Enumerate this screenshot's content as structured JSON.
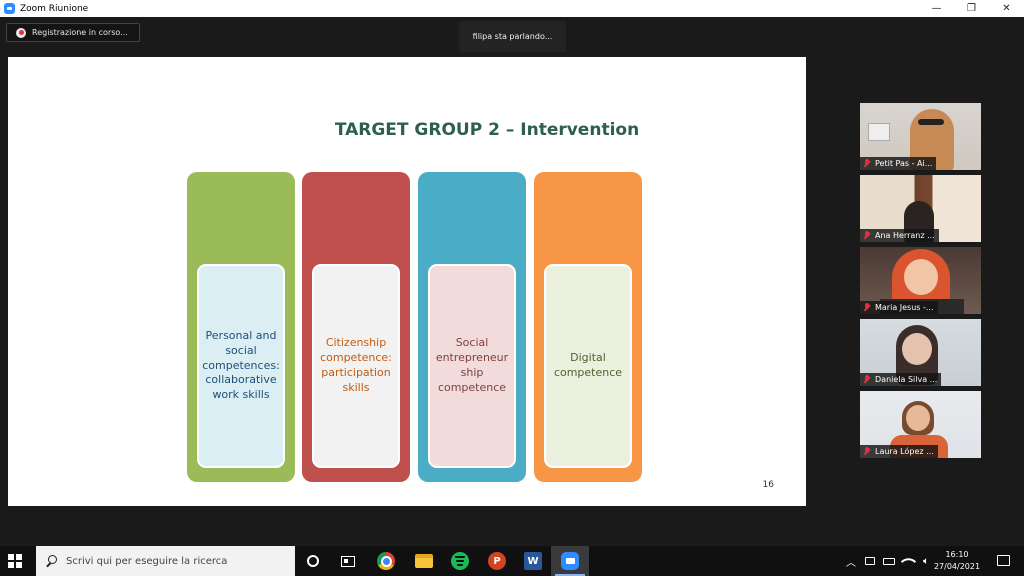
{
  "window": {
    "title": "Zoom Riunione",
    "minimize": "—",
    "restore": "❐",
    "close": "✕"
  },
  "meeting": {
    "recording_label": "Registrazione in corso...",
    "speaking_label": "filipa sta parlando..."
  },
  "slide": {
    "title": "TARGET GROUP 2 – Intervention",
    "page_number": "16",
    "columns": [
      {
        "text": "Personal and social competences: collaborative work skills",
        "outer_color": "#9bbb59",
        "inner_color": "#dbeef4",
        "text_color": "#1f4e79"
      },
      {
        "text": "Citizenship competence: participation skills",
        "outer_color": "#c0504d",
        "inner_color": "#f2f2f2",
        "text_color": "#c55a11"
      },
      {
        "text": "Social entrepreneur ship competence",
        "outer_color": "#4bacc6",
        "inner_color": "#f2dcdb",
        "text_color": "#7f3f3f"
      },
      {
        "text": "Digital competence",
        "outer_color": "#f79646",
        "inner_color": "#ebf1de",
        "text_color": "#4f6228"
      }
    ]
  },
  "participants": [
    {
      "name": "Petit Pas - Ai..."
    },
    {
      "name": "Ana Herranz ..."
    },
    {
      "name": "Maria Jesus -..."
    },
    {
      "name": "Daniela Silva ..."
    },
    {
      "name": "Laura López ..."
    }
  ],
  "taskbar": {
    "search_placeholder": "Scrivi qui per eseguire la ricerca",
    "ppt_letter": "P",
    "word_letter": "W",
    "time": "16:10",
    "date": "27/04/2021"
  }
}
